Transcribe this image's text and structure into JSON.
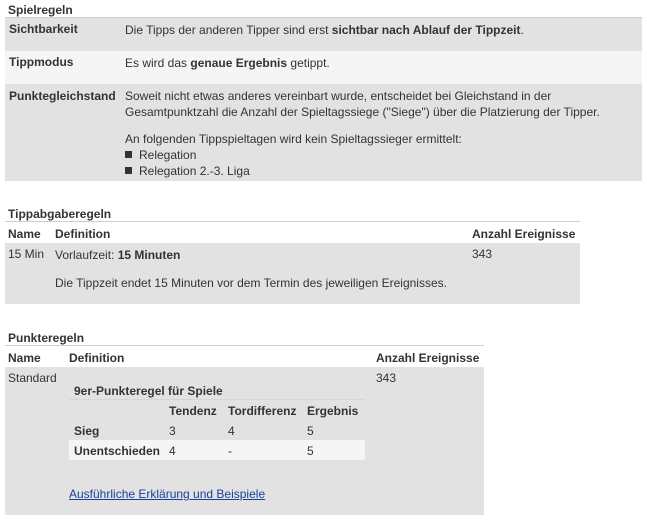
{
  "spielregeln": {
    "title": "Spielregeln",
    "rows": [
      {
        "label": "Sichtbarkeit",
        "text_pre": "Die Tipps der anderen Tipper sind erst ",
        "text_bold": "sichtbar nach Ablauf der Tippzeit",
        "text_post": "."
      },
      {
        "label": "Tippmodus",
        "text_pre": "Es wird das ",
        "text_bold": "genaue Ergebnis",
        "text_post": " getippt."
      },
      {
        "label": "Punktegleichstand",
        "line1": "Soweit nicht etwas anderes vereinbart wurde, entscheidet bei Gleichstand in der",
        "line2": "Gesamtpunktzahl die Anzahl der Spieltagssiege (\"Siege\") über die Platzierung der Tipper.",
        "line3": "An folgenden Tippspieltagen wird kein Spieltagssieger ermittelt:",
        "bullets": [
          "Relegation",
          "Relegation 2.-3. Liga"
        ]
      }
    ]
  },
  "tippabgaberegeln": {
    "title": "Tippabgaberegeln",
    "headers": {
      "name": "Name",
      "definition": "Definition",
      "count": "Anzahl Ereignisse"
    },
    "row": {
      "name": "15 Min",
      "def_pre": "Vorlaufzeit: ",
      "def_bold": "15 Minuten",
      "count": "343",
      "note": "Die Tippzeit endet 15 Minuten vor dem Termin des jeweiligen Ereignisses."
    }
  },
  "punkteregeln": {
    "title": "Punkteregeln",
    "headers": {
      "name": "Name",
      "definition": "Definition",
      "count": "Anzahl Ereignisse"
    },
    "row": {
      "name": "Standard",
      "count": "343",
      "table_title": "9er-Punkteregel für Spiele",
      "cols": [
        "Tendenz",
        "Tordifferenz",
        "Ergebnis"
      ],
      "rows": [
        {
          "label": "Sieg",
          "values": [
            "3",
            "4",
            "5"
          ]
        },
        {
          "label": "Unentschieden",
          "values": [
            "4",
            "-",
            "5"
          ]
        }
      ],
      "link": "Ausführliche Erklärung und Beispiele"
    }
  }
}
